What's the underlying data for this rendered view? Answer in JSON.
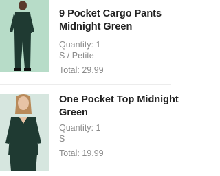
{
  "cart": {
    "items": [
      {
        "name_line1": "9 Pocket Cargo Pants",
        "name_line2": "Midnight Green",
        "quantity": "Quantity: 1",
        "size": "S / Petite",
        "total": "Total: 29.99",
        "thumb_bg": "#b7dcc8",
        "garment_color": "#1f3a32"
      },
      {
        "name_line1": "One Pocket Top Midnight",
        "name_line2": "Green",
        "quantity": "Quantity: 1",
        "size": "S",
        "total": "Total: 19.99",
        "thumb_bg": "#d6e6df",
        "garment_color": "#1f3a32"
      }
    ]
  }
}
